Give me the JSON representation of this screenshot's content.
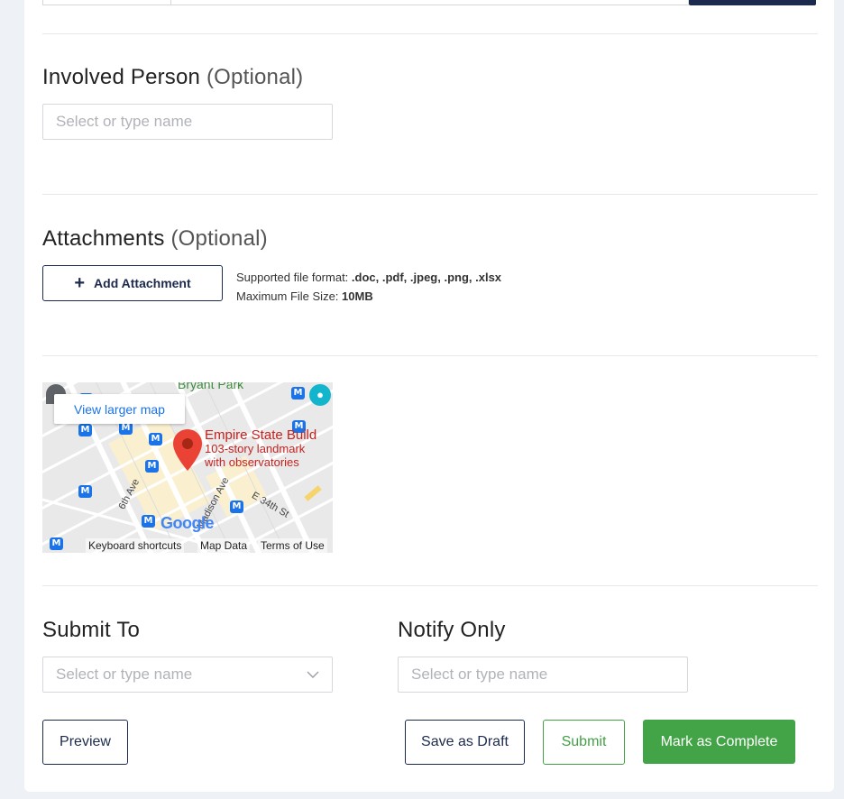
{
  "involved": {
    "title": "Involved Person",
    "optional": "(Optional)",
    "placeholder": "Select or type name"
  },
  "attachments": {
    "title": "Attachments",
    "optional": "(Optional)",
    "add_label": "Add Attachment",
    "format_label": "Supported file format: ",
    "format_value": ".doc, .pdf, .jpeg, .png, .xlsx",
    "size_label": "Maximum File Size: ",
    "size_value": "10MB"
  },
  "map": {
    "view_larger": "View larger map",
    "place_name": "Empire State Build",
    "place_desc1": "103-story landmark",
    "place_desc2": "with observatories",
    "area_label": "Bryant Park",
    "street1": "6th Ave",
    "street2": "Madison Ave",
    "street3": "E 34th St",
    "google": "Google",
    "keyboard": "Keyboard shortcuts",
    "map_data": "Map Data",
    "terms": "Terms of Use"
  },
  "submit_to": {
    "title": "Submit To",
    "placeholder": "Select or type name"
  },
  "notify_only": {
    "title": "Notify Only",
    "placeholder": "Select or type name"
  },
  "actions": {
    "preview": "Preview",
    "save_draft": "Save as Draft",
    "submit": "Submit",
    "mark_complete": "Mark as Complete"
  },
  "colors": {
    "primary_dark": "#1c2a4d",
    "success": "#43a447",
    "map_pin": "#ea4335"
  }
}
